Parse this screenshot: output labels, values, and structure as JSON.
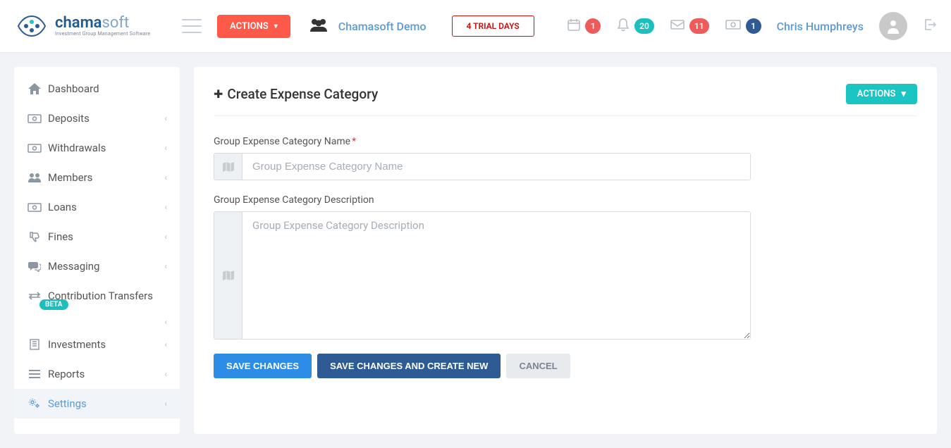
{
  "header": {
    "brand_main": "chama",
    "brand_accent": "soft",
    "brand_sub": "Investment Group Management Software",
    "top_actions_label": "ACTIONS",
    "group_name": "Chamasoft Demo",
    "trial_label": "4 TRIAL DAYS",
    "notifications": {
      "calendar": "1",
      "bell": "20",
      "mail": "11",
      "money": "1"
    },
    "user_name": "Chris Humphreys"
  },
  "sidebar": {
    "items": [
      {
        "label": "Dashboard",
        "icon": "home",
        "expandable": false
      },
      {
        "label": "Deposits",
        "icon": "money",
        "expandable": true
      },
      {
        "label": "Withdrawals",
        "icon": "money",
        "expandable": true
      },
      {
        "label": "Members",
        "icon": "users",
        "expandable": true
      },
      {
        "label": "Loans",
        "icon": "money",
        "expandable": true
      },
      {
        "label": "Fines",
        "icon": "thumbs-down",
        "expandable": true
      },
      {
        "label": "Messaging",
        "icon": "chat",
        "expandable": true
      },
      {
        "label": "Contribution Transfers",
        "icon": "transfer",
        "expandable": true,
        "beta": "BETA"
      },
      {
        "label": "Investments",
        "icon": "building",
        "expandable": true
      },
      {
        "label": "Reports",
        "icon": "list",
        "expandable": true
      },
      {
        "label": "Settings",
        "icon": "cogs",
        "expandable": true,
        "active": true
      }
    ]
  },
  "page": {
    "title": "Create Expense Category",
    "actions_label": "ACTIONS",
    "form": {
      "name_label": "Group Expense Category Name",
      "name_placeholder": "Group Expense Category Name",
      "desc_label": "Group Expense Category Description",
      "desc_placeholder": "Group Expense Category Description"
    },
    "buttons": {
      "save": "SAVE CHANGES",
      "save_new": "SAVE CHANGES AND CREATE NEW",
      "cancel": "CANCEL"
    }
  }
}
